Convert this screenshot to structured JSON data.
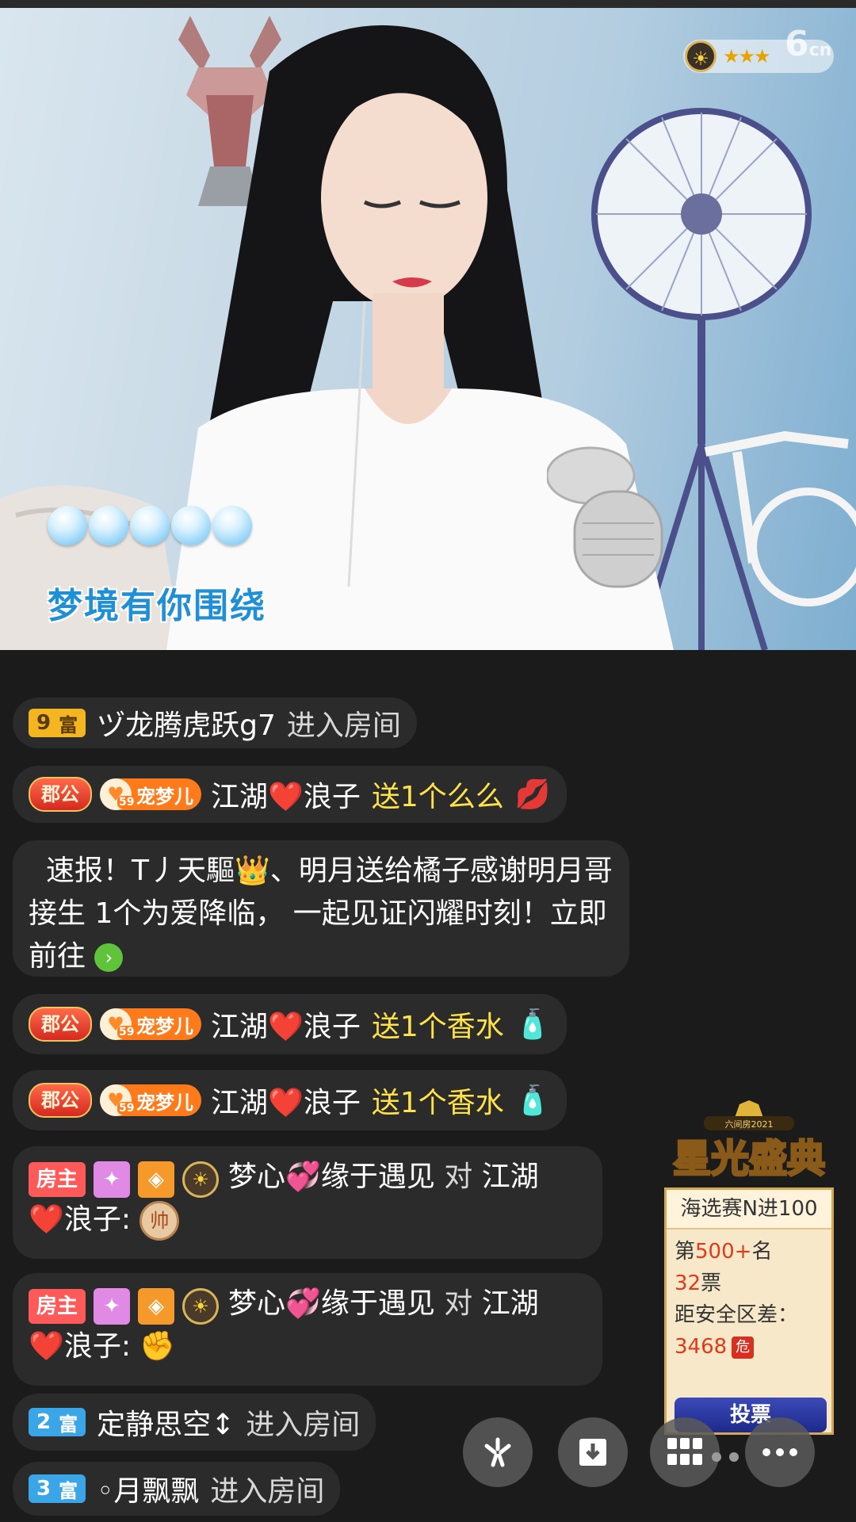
{
  "video": {
    "lyric": "梦境有你围绕",
    "stars_badge": "★★★",
    "logo": "6",
    "logo_suffix": "cn"
  },
  "chat": [
    {
      "type": "enter",
      "rich_level": "9",
      "rich_label": "富",
      "user": "ヅ龙腾虎跃g7",
      "action": "进入房间"
    },
    {
      "type": "gift",
      "title_badge": "郡公",
      "fan_badge": "宠梦儿",
      "fan_level": "59",
      "user": "江湖❤️浪子",
      "action": "送1个么么",
      "gift_icon": "kiss-lips-icon"
    },
    {
      "type": "notice",
      "text": "速报！T丿天驅👑、明月送给橘子感谢明月哥接生 1个为爱降临， 一起见证闪耀时刻！立即前往"
    },
    {
      "type": "gift",
      "title_badge": "郡公",
      "fan_badge": "宠梦儿",
      "fan_level": "59",
      "user": "江湖❤️浪子",
      "action": "送1个香水",
      "gift_icon": "perfume-icon"
    },
    {
      "type": "gift",
      "title_badge": "郡公",
      "fan_badge": "宠梦儿",
      "fan_level": "59",
      "user": "江湖❤️浪子",
      "action": "送1个香水",
      "gift_icon": "perfume-icon"
    },
    {
      "type": "reply",
      "role": "房主",
      "user": "梦心💞缘于遇见",
      "to_label": "对",
      "target": "江湖",
      "target2": "❤️浪子:",
      "chip": "帅"
    },
    {
      "type": "reply",
      "role": "房主",
      "user": "梦心💞缘于遇见",
      "to_label": "对",
      "target": "江湖",
      "target2": "❤️浪子:",
      "emoji": "✊"
    },
    {
      "type": "enter",
      "rich_level": "2",
      "rich_label": "富",
      "user": "定静思空↕",
      "action": "进入房间"
    },
    {
      "type": "enter",
      "rich_level": "3",
      "rich_label": "富",
      "user": "◦月飘飘",
      "action": "进入房间"
    }
  ],
  "event": {
    "badge": "六间房2021",
    "title": "星光盛典",
    "stage": "海选赛N进100",
    "rank_prefix": "第",
    "rank_value": "500+",
    "rank_suffix": "名",
    "votes_value": "32",
    "votes_suffix": "票",
    "gap_label": "距安全区差：",
    "gap_value": "3468",
    "danger": "危",
    "vote_button": "投票"
  },
  "colors": {
    "gift_text": "#ffe14a",
    "bubble_bg": "#2c2c2c",
    "host_badge": "#ff5a5a"
  }
}
